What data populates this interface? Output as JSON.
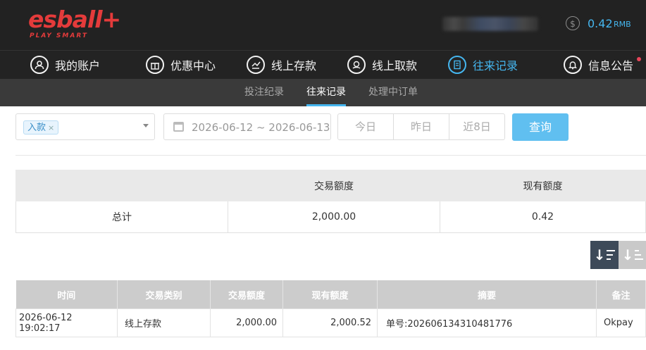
{
  "header": {
    "logo_main": "esball+",
    "logo_sub": "PLAY SMART",
    "balance_icon": "dollar-icon",
    "balance_value": "0.42",
    "balance_unit": "RMB",
    "accent": "#45b6ef"
  },
  "nav": {
    "items": [
      {
        "label": "我的账户",
        "icon": "user-icon"
      },
      {
        "label": "优惠中心",
        "icon": "gift-icon"
      },
      {
        "label": "线上存款",
        "icon": "deposit-icon"
      },
      {
        "label": "线上取款",
        "icon": "withdraw-icon"
      },
      {
        "label": "往来记录",
        "icon": "records-icon",
        "active": true
      },
      {
        "label": "信息公告",
        "icon": "bell-icon"
      }
    ]
  },
  "subnav": {
    "items": [
      {
        "label": "投注纪录"
      },
      {
        "label": "往来记录",
        "active": true
      },
      {
        "label": "处理中订单"
      }
    ]
  },
  "filters": {
    "type_tag": "入款",
    "date_range": "2026-06-12 ~ 2026-06-13",
    "quick": [
      "今日",
      "昨日",
      "近8日"
    ],
    "query_label": "查询"
  },
  "summary": {
    "headers": [
      "",
      "交易额度",
      "现有额度"
    ],
    "row": {
      "label": "总计",
      "amount": "2,000.00",
      "balance": "0.42"
    }
  },
  "sort": {
    "desc_icon": "sort-desc-icon",
    "asc_icon": "sort-asc-icon"
  },
  "table": {
    "headers": [
      "时间",
      "交易类别",
      "交易额度",
      "现有额度",
      "摘要",
      "备注"
    ],
    "rows": [
      {
        "time": "2026-06-12 19:02:17",
        "type": "线上存款",
        "amount": "2,000.00",
        "balance": "2,000.52",
        "summary": "单号:202606134310481776",
        "note": "Okpay"
      }
    ]
  }
}
